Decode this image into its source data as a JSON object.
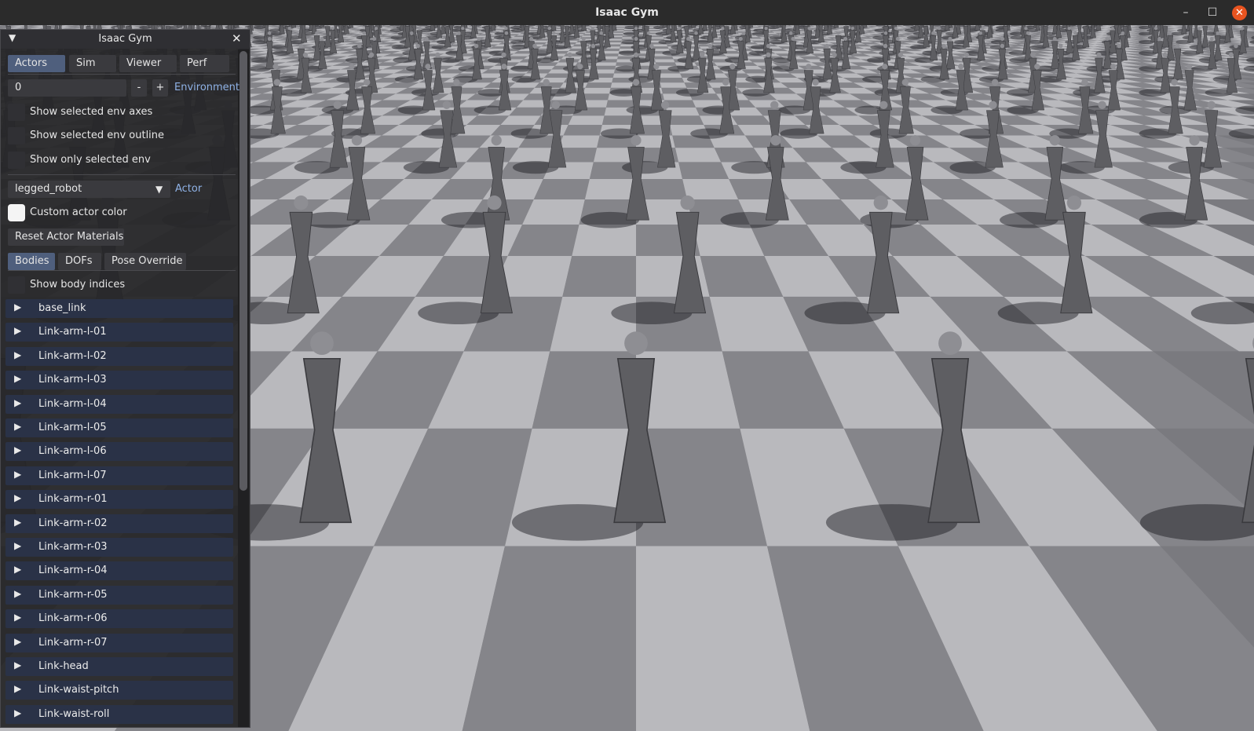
{
  "window": {
    "title": "Isaac Gym",
    "minimize": "–",
    "maximize": "☐",
    "close": "✕"
  },
  "panel": {
    "title": "Isaac Gym",
    "collapse": "▼",
    "close": "✕",
    "tabs": [
      "Actors",
      "Sim",
      "Viewer",
      "Perf"
    ],
    "active_tab": "Actors",
    "env_index": "0",
    "minus": "-",
    "plus": "+",
    "env_label": "Environment",
    "env_checks": [
      {
        "label": "Show selected env axes",
        "checked": false
      },
      {
        "label": "Show selected env outline",
        "checked": false
      },
      {
        "label": "Show only selected env",
        "checked": false
      }
    ],
    "actor_select": "legged_robot",
    "actor_arrow": "▼",
    "actor_label": "Actor",
    "custom_color_label": "Custom actor color",
    "reset_button": "Reset Actor Materials",
    "subtabs": [
      "Bodies",
      "DOFs",
      "Pose Override"
    ],
    "active_subtab": "Bodies",
    "show_body_indices": "Show body indices",
    "expand_arrow": "▶",
    "bodies": [
      "base_link",
      "Link-arm-l-01",
      "Link-arm-l-02",
      "Link-arm-l-03",
      "Link-arm-l-04",
      "Link-arm-l-05",
      "Link-arm-l-06",
      "Link-arm-l-07",
      "Link-arm-r-01",
      "Link-arm-r-02",
      "Link-arm-r-03",
      "Link-arm-r-04",
      "Link-arm-r-05",
      "Link-arm-r-06",
      "Link-arm-r-07",
      "Link-head",
      "Link-waist-pitch",
      "Link-waist-roll"
    ]
  },
  "viewport": {
    "floor_colors": {
      "light": "#b9b9bd",
      "dark": "#85858a"
    },
    "robot_color": "#5e5e62"
  }
}
